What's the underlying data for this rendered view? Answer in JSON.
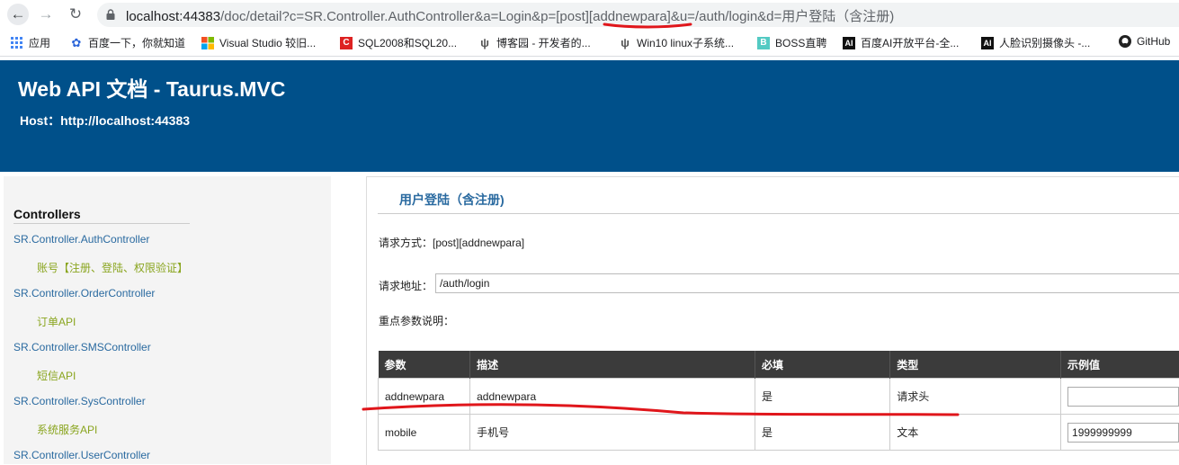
{
  "browser": {
    "url_host": "localhost:44383",
    "url_rest": "/doc/detail?c=SR.Controller.AuthController&a=Login&p=[post][addnewpara]&u=/auth/login&d=用户登陆（含注册)",
    "bookmarks": [
      {
        "label": "应用",
        "icon": "apps-grid-icon",
        "color": "#4285f4"
      },
      {
        "label": "百度一下，你就知道",
        "icon": "baidu-paw-icon",
        "color": "#2b65d9"
      },
      {
        "label": "Visual Studio 较旧...",
        "icon": "microsoft-logo-icon",
        "color": "#f25022"
      },
      {
        "label": "SQL2008和SQL20...",
        "icon": "c-red-icon",
        "color": "#d22"
      },
      {
        "label": "博客园 - 开发者的...",
        "icon": "cnblogs-icon",
        "color": "#555"
      },
      {
        "label": "Win10 linux子系统...",
        "icon": "cnblogs-icon",
        "color": "#555"
      },
      {
        "label": "BOSS直聘",
        "icon": "boss-icon",
        "color": "#53cac3"
      },
      {
        "label": "百度AI开放平台-全...",
        "icon": "ai-icon",
        "color": "#111"
      },
      {
        "label": "人脸识别摄像头 -...",
        "icon": "ai-icon",
        "color": "#111"
      },
      {
        "label": "GitHub",
        "icon": "github-icon",
        "color": "#222"
      }
    ]
  },
  "header": {
    "title": "Web API 文档 - Taurus.MVC",
    "host": "Host：http://localhost:44383"
  },
  "sidebar": {
    "title": "Controllers",
    "items": [
      {
        "controller": "SR.Controller.AuthController",
        "desc": "账号【注册、登陆、权限验证】"
      },
      {
        "controller": "SR.Controller.OrderController",
        "desc": "订单API"
      },
      {
        "controller": "SR.Controller.SMSController",
        "desc": "短信API"
      },
      {
        "controller": "SR.Controller.SysController",
        "desc": "系统服务API"
      },
      {
        "controller": "SR.Controller.UserController",
        "desc": ""
      }
    ]
  },
  "main": {
    "title": "用户登陆（含注册)",
    "method_label": "请求方式：[post][addnewpara]",
    "url_label": "请求地址：",
    "url_value": "/auth/login",
    "params_label": "重点参数说明：",
    "table": {
      "headers": [
        "参数",
        "描述",
        "必填",
        "类型",
        "示例值"
      ],
      "rows": [
        {
          "param": "addnewpara",
          "desc": "addnewpara",
          "required": "是",
          "type": "请求头",
          "example": ""
        },
        {
          "param": "mobile",
          "desc": "手机号",
          "required": "是",
          "type": "文本",
          "example": "1999999999"
        }
      ]
    }
  },
  "colors": {
    "header_bg": "#00508a",
    "link": "#2a6aa0",
    "sub_link": "#8aa51f",
    "annotation": "#e0161b"
  }
}
